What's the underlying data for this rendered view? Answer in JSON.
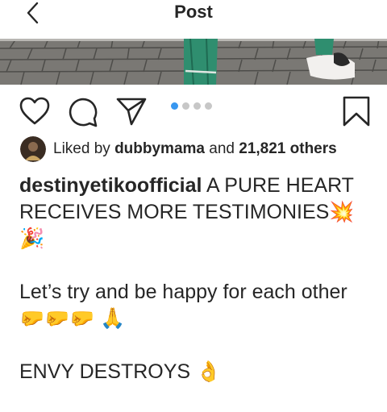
{
  "header": {
    "title": "Post",
    "back_icon": "chevron-left-icon"
  },
  "photo": {
    "description_colors": {
      "pavement": "#6f6e6a",
      "pants": "#2f8e6f",
      "sandal": "#f2f0ee"
    }
  },
  "actions": {
    "icons": [
      "heart-icon",
      "comment-icon",
      "share-icon",
      "bookmark-icon"
    ],
    "carousel_total": 4,
    "carousel_active": 1
  },
  "likes": {
    "prefix": "Liked by",
    "user": "dubbymama",
    "conjunction": "and",
    "count": "21,821 others"
  },
  "caption": {
    "username": "destinyetikoofficial",
    "line1_text": "A PURE HEART RECEIVES MORE TESTIMONIES",
    "line1_emoji": "💥",
    "line2_emoji": "🎉",
    "line3_text": "Let’s try and be happy for each other",
    "line3_emoji": "🤛🤛🤛 🙏",
    "line4_text": "ENVY DESTROYS",
    "line4_emoji": "👌"
  },
  "colors": {
    "accent": "#3897f0",
    "text": "#262626"
  }
}
